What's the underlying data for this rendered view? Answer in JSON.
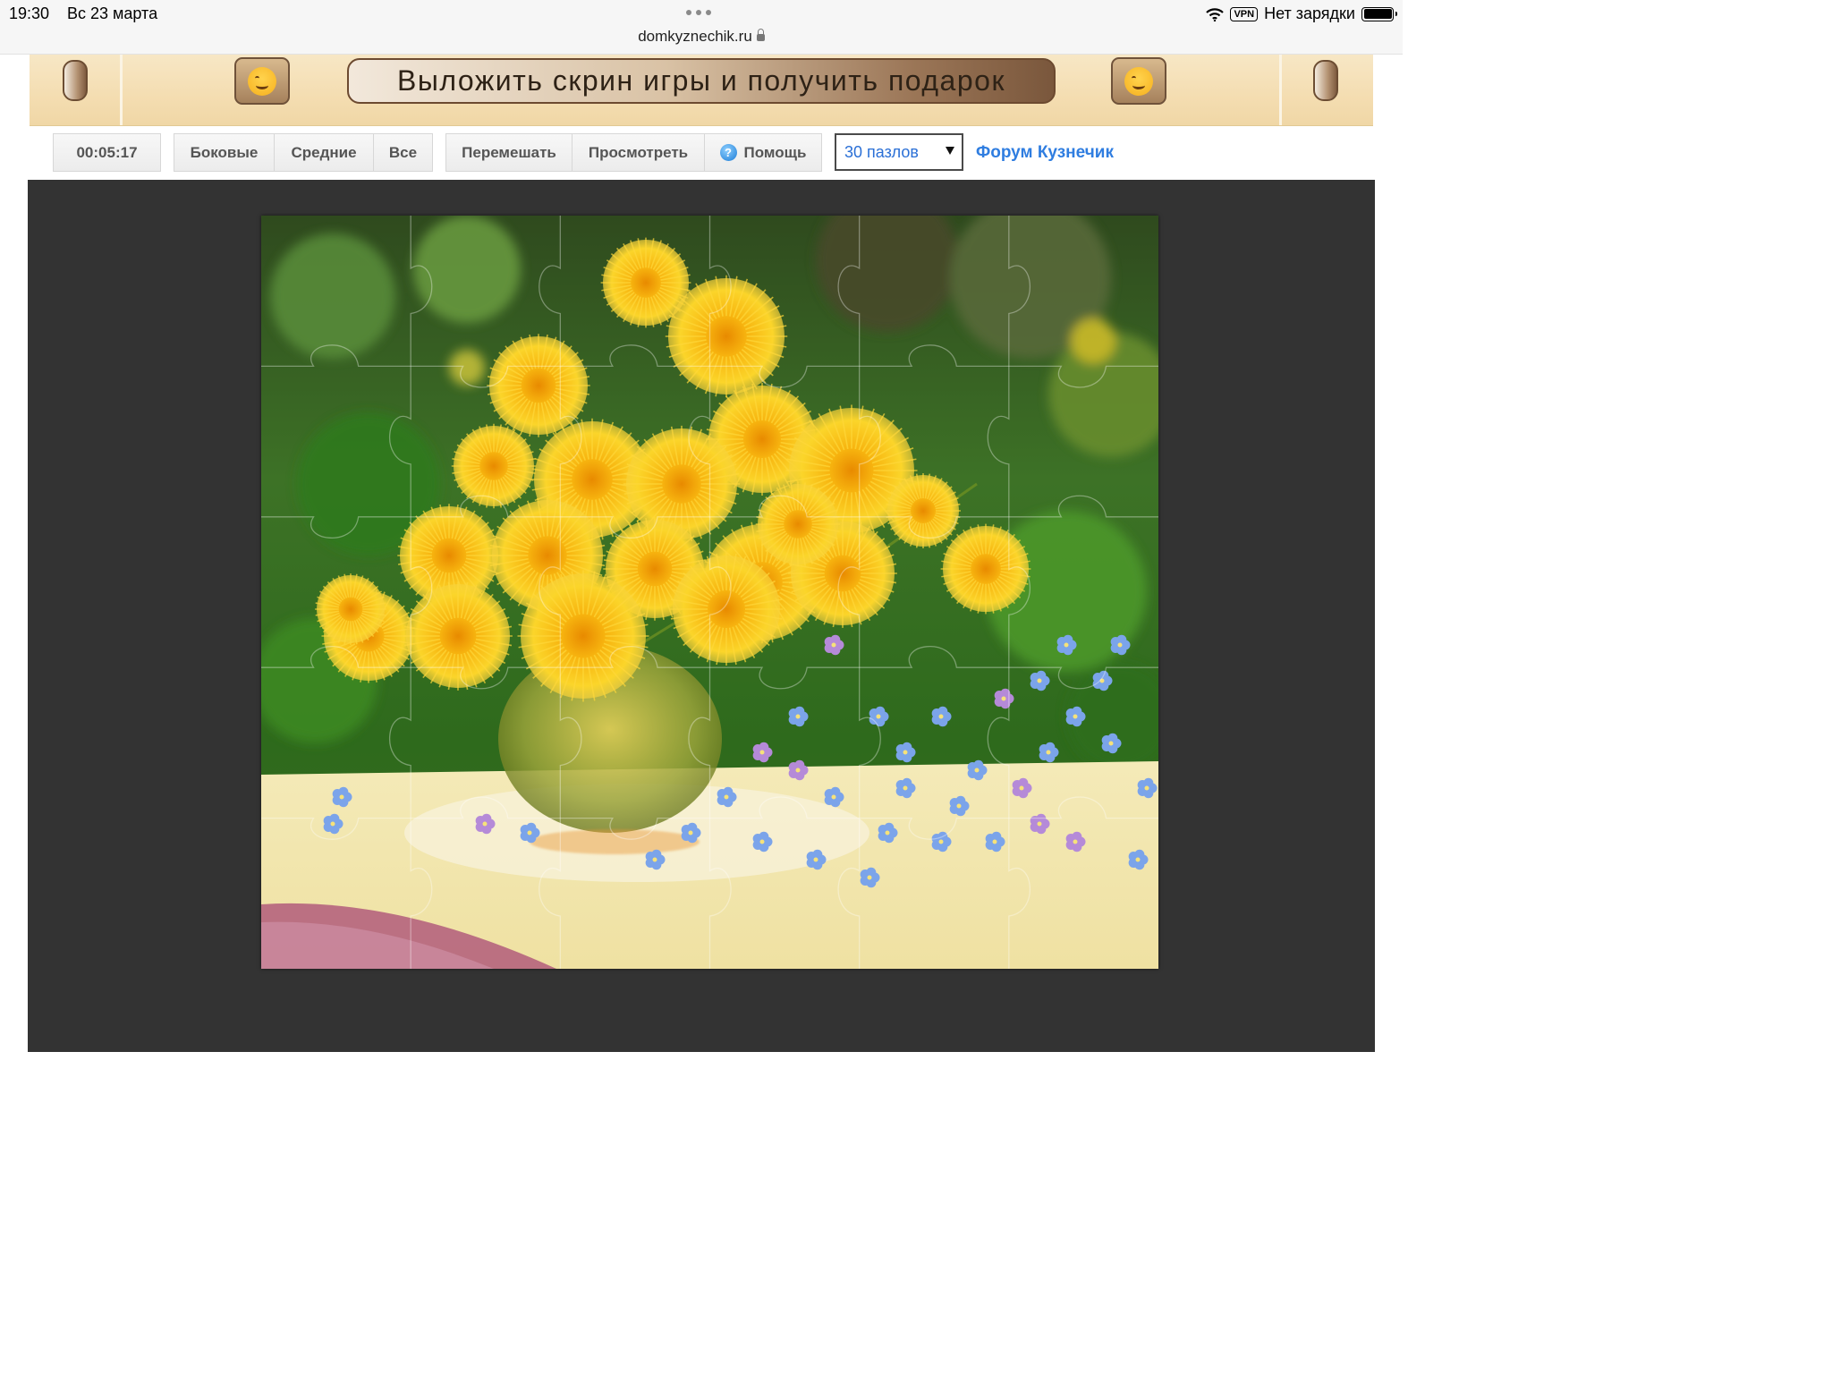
{
  "status_bar": {
    "time": "19:30",
    "date": "Вс 23 марта",
    "url": "domkyznechik.ru",
    "vpn_label": "VPN",
    "charging_text": "Нет зарядки"
  },
  "banner": {
    "cta_label": "Выложить скрин игры и получить подарок",
    "left_icon": "smiling-hugging-face-emoji",
    "right_icon": "smiling-hugging-face-emoji"
  },
  "toolbar": {
    "timer": "00:05:17",
    "edges_label": "Боковые",
    "middles_label": "Средние",
    "all_label": "Все",
    "shuffle_label": "Перемешать",
    "preview_label": "Просмотреть",
    "help_label": "Помощь",
    "help_icon": "question-icon",
    "pieces_select": {
      "selected": "30 пазлов"
    },
    "forum_link": "Форум Кузнечик"
  },
  "puzzle": {
    "image_subject": "bouquet of yellow dandelions and blue forget-me-nots in a glass vase on a table",
    "grid": {
      "columns": 6,
      "rows": 5
    },
    "colors": {
      "background": "#333333",
      "flower_yellow": "#f5c518",
      "forget_me_not_blue": "#6f9be6",
      "foliage_green": "#3f7a22"
    }
  }
}
